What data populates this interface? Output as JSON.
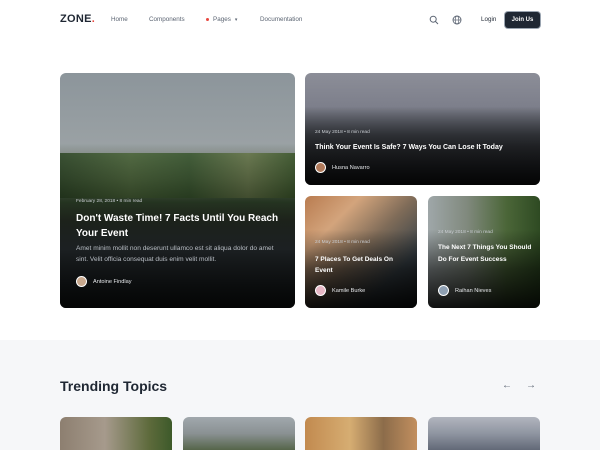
{
  "nav": {
    "logo": "ZONE",
    "logo_dot": ".",
    "links": {
      "home": "Home",
      "components": "Components",
      "pages": "Pages",
      "documentation": "Documentation"
    },
    "login": "Login",
    "join": "Join Us",
    "accent_color": "#e8473f"
  },
  "featured": [
    {
      "meta": "February 28, 2018  •  8 min read",
      "title": "Don't Waste Time! 7 Facts Until You Reach Your Event",
      "excerpt": "Amet minim mollit non deserunt ullamco est sit aliqua dolor do amet sint. Velit officia consequat duis enim velit mollit.",
      "author": "Antoine Findlay"
    },
    {
      "meta": "24 May 2018  •  8 min read",
      "title": "Think Your Event Is Safe? 7 Ways You Can Lose It Today",
      "author": "Husna Navarro"
    },
    {
      "meta": "24 May 2018  •  8 min read",
      "title": "7 Places To Get Deals On Event",
      "author": "Kamile Burke"
    },
    {
      "meta": "24 May 2018  •  8 min read",
      "title": "The Next 7 Things You Should Do For Event Success",
      "author": "Raihan Nieves"
    }
  ],
  "trending": {
    "title": "Trending Topics",
    "prev": "←",
    "next": "→"
  },
  "icons": {
    "search": "search-icon",
    "globe": "globe-icon"
  }
}
